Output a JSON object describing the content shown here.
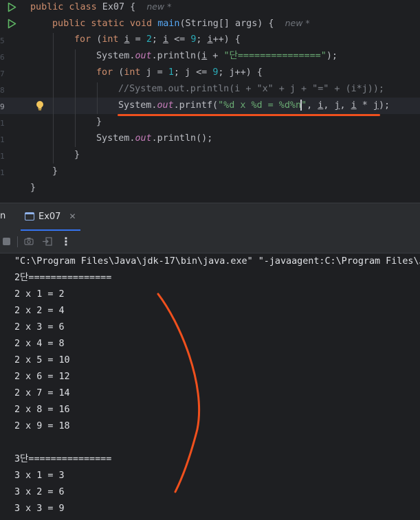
{
  "editor": {
    "hint_new": "new *",
    "lines": {
      "l1": {
        "kw": "public class",
        "name": " Ex07 {"
      },
      "l2": {
        "kw1": "public static",
        "kw2": " void ",
        "fn": "main",
        "rest": "(String[] args) {"
      },
      "l3": {
        "kw": "for",
        "a": " (",
        "kw2": "int",
        "b": " ",
        "v1": "i",
        "c": " = ",
        "n1": "2",
        "d": "; ",
        "v2": "i",
        "e": " <= ",
        "n2": "9",
        "f": "; ",
        "v3": "i",
        "g": "++) {"
      },
      "l4": {
        "a": "System.",
        "field": "out",
        "b": ".println(",
        "v": "i",
        "c": " + ",
        "str": "\"단===============\"",
        "d": ");"
      },
      "l5": {
        "kw": "for",
        "a": " (",
        "kw2": "int",
        "b": " j = ",
        "n1": "1",
        "c": "; j <= ",
        "n2": "9",
        "d": "; j++) {"
      },
      "l6": {
        "cmt": "//System.out.println(i + \"x\" + j + \"=\" + (i*j));"
      },
      "l7": {
        "a": "System.",
        "field": "out",
        "b": ".printf(",
        "str1": "\"%d x %d = %d%n",
        "str2": "\"",
        "c": ", ",
        "v1": "i",
        "d": ", ",
        "v2": "j",
        "e": ", ",
        "v3": "i",
        "f": " * ",
        "v4": "j",
        "g": ");"
      },
      "l8": "}",
      "l9": {
        "a": "System.",
        "field": "out",
        "b": ".println();"
      },
      "l10": "}",
      "l11": "}",
      "l12": "}"
    }
  },
  "tool_window": {
    "left_tab_label": "n",
    "tab_label": "Ex07",
    "close_glyph": "✕",
    "more_glyph": "⋮"
  },
  "console": {
    "lines": [
      "\"C:\\Program Files\\Java\\jdk-17\\bin\\java.exe\" \"-javaagent:C:\\Program Files\\J",
      "2단===============",
      "2 x 1 = 2",
      "2 x 2 = 4",
      "2 x 3 = 6",
      "2 x 4 = 8",
      "2 x 5 = 10",
      "2 x 6 = 12",
      "2 x 7 = 14",
      "2 x 8 = 16",
      "2 x 9 = 18",
      "",
      "3단===============",
      "3 x 1 = 3",
      "3 x 2 = 6",
      "3 x 3 = 9"
    ]
  },
  "colors": {
    "background": "#1e1f22",
    "keyword": "#cf8e6d",
    "function": "#56a8f5",
    "number": "#2aacb8",
    "string": "#6aab73",
    "field": "#c77dbb",
    "comment": "#7a7e85",
    "annotation": "#f0501d",
    "run_icon": "#5fb865"
  }
}
